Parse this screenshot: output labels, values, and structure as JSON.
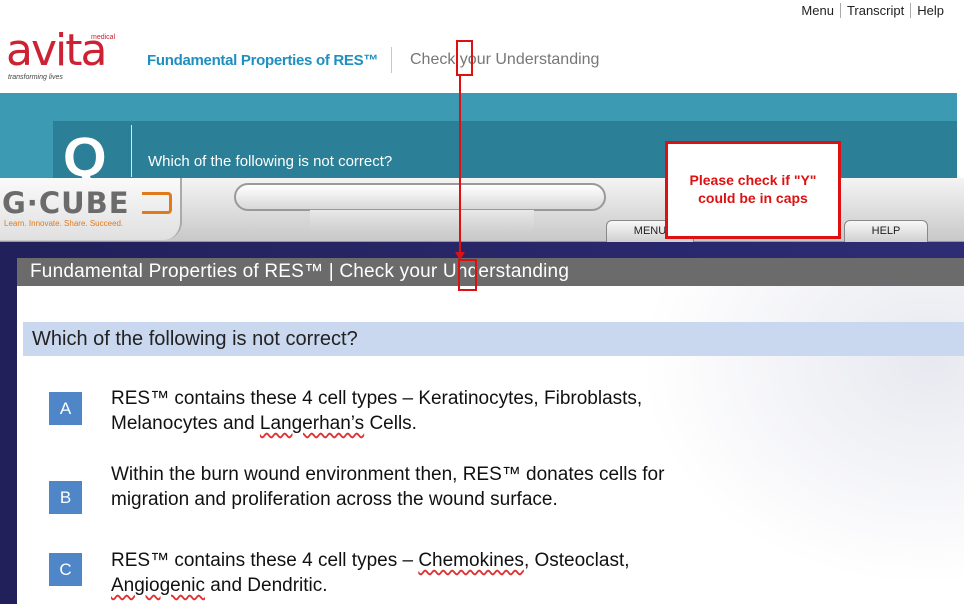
{
  "top_nav": {
    "items": [
      "Menu",
      "Transcript",
      "Help"
    ]
  },
  "logo": {
    "word": "avita",
    "superscript": "medical",
    "tagline": "transforming lives"
  },
  "header": {
    "title": "Fundamental Properties of RES™",
    "subtitle": "Check your Understanding"
  },
  "banner": {
    "letter": "Q",
    "question": "Which of the following is not correct?"
  },
  "player": {
    "brand": "G·CUBE",
    "brand_tagline": "Learn. Innovate. Share. Succeed.",
    "menu_label": "MENU",
    "help_label": "HELP"
  },
  "slide": {
    "title": "Fundamental Properties of RES™ | Check your Understanding",
    "question": "Which of the following is not correct?",
    "options": [
      {
        "letter": "A",
        "line1": "RES™ contains these 4 cell types – Keratinocytes, Fibroblasts,",
        "line2_prefix": "Melanocytes and ",
        "line2_squiggle": "Langerhan’s",
        "line2_suffix": " Cells."
      },
      {
        "letter": "B",
        "line1": "Within the burn wound environment then, RES™ donates cells for",
        "line2": "migration and proliferation across the wound surface."
      },
      {
        "letter": "C",
        "line1_prefix": "RES™ contains these 4 cell types – ",
        "line1_squiggle": "Chemokines",
        "line1_suffix": ", Osteoclast,",
        "line2_squiggle": "Angiogenic",
        "line2_suffix": " and Dendritic."
      }
    ]
  },
  "annotation": {
    "callout_line1": "Please check if \"Y\"",
    "callout_line2": "could be in caps",
    "color": "#dd1111"
  }
}
